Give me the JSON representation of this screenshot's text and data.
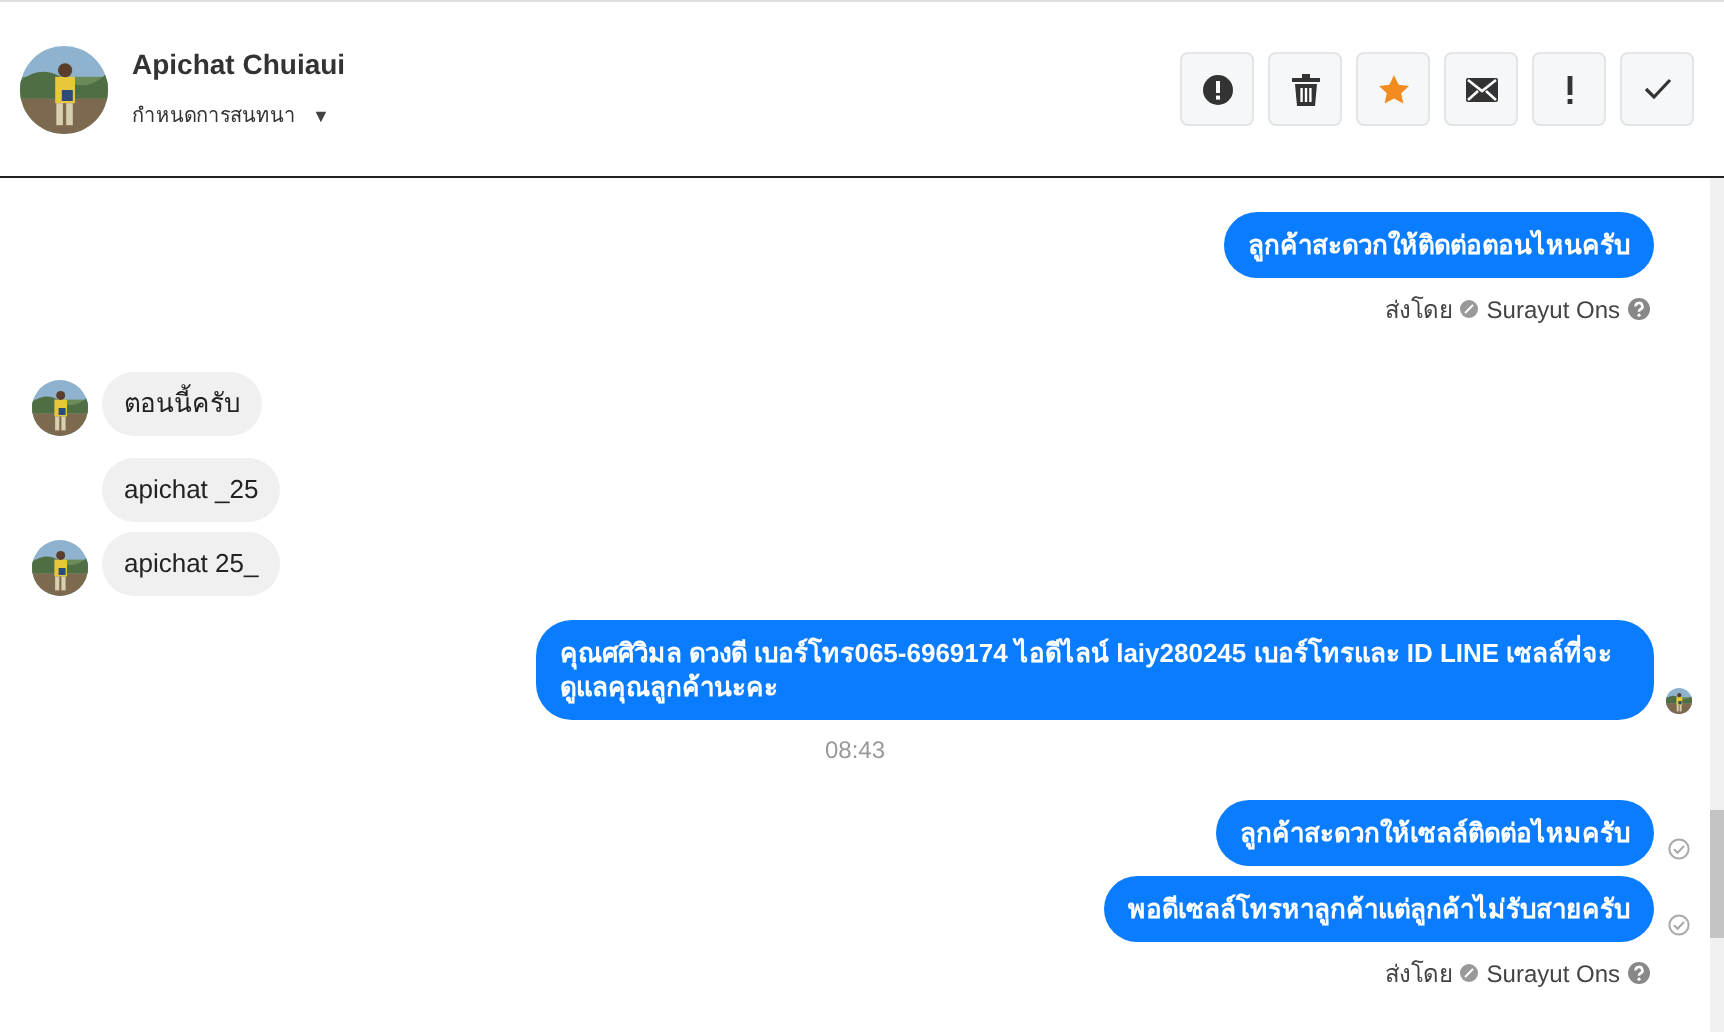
{
  "header": {
    "name": "Apichat Chuiaui",
    "subtitle": "กำหนดการสนทนา",
    "caret": "▼",
    "buttons": [
      {
        "kind": "alert",
        "active": false
      },
      {
        "kind": "trash",
        "active": false
      },
      {
        "kind": "star",
        "active": true
      },
      {
        "kind": "mail",
        "active": false
      },
      {
        "kind": "exclaim",
        "active": false
      },
      {
        "kind": "check",
        "active": false
      }
    ]
  },
  "messages": [
    {
      "kind": "outgoing",
      "text": "ลูกค้าสะดวกให้ติดต่อตอนไหนครับ",
      "seen": false,
      "sent_check": false
    },
    {
      "kind": "sent_by",
      "label": "ส่งโดย",
      "agent": "Surayut Ons"
    },
    {
      "kind": "incoming",
      "text": "ตอนนี้ครับ",
      "avatar": true
    },
    {
      "kind": "incoming",
      "text": "apichat _25",
      "avatar": false
    },
    {
      "kind": "incoming",
      "text": "apichat 25_",
      "avatar": true
    },
    {
      "kind": "outgoing",
      "text": "คุณศศิวิมล ดวงดี เบอร์โทร065-6969174 ไอดีไลน์ laiy280245 เบอร์โทรและ ID LINE เซลล์ที่จะดูแลคุณลูกค้านะคะ",
      "seen": true,
      "sent_check": false
    },
    {
      "kind": "time",
      "text": "08:43"
    },
    {
      "kind": "outgoing",
      "text": "ลูกค้าสะดวกให้เซลล์ติดต่อไหมครับ",
      "seen": false,
      "sent_check": true
    },
    {
      "kind": "outgoing",
      "text": "พอดีเซลล์โทรหาลูกค้าแต่ลูกค้าไม่รับสายครับ",
      "seen": false,
      "sent_check": true
    },
    {
      "kind": "sent_by",
      "label": "ส่งโดย",
      "agent": "Surayut Ons"
    }
  ]
}
